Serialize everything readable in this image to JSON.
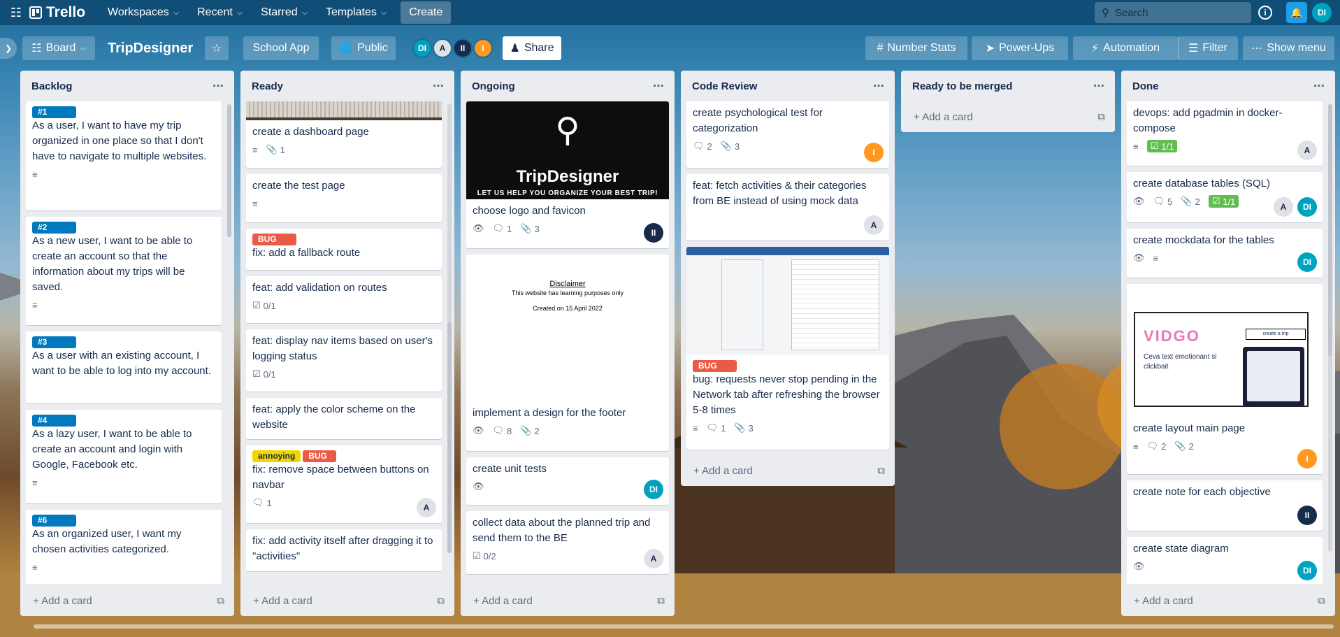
{
  "app": {
    "name": "Trello"
  },
  "topnav": {
    "items": [
      {
        "label": "Workspaces"
      },
      {
        "label": "Recent"
      },
      {
        "label": "Starred"
      },
      {
        "label": "Templates"
      }
    ],
    "create_label": "Create",
    "search_placeholder": "Search",
    "user_initials": "DI"
  },
  "boardbar": {
    "view_label": "Board",
    "title": "TripDesigner",
    "workspace_label": "School App",
    "visibility_label": "Public",
    "members": [
      "DI",
      "A",
      "II",
      "I"
    ],
    "share_label": "Share",
    "number_stats_label": "Number Stats",
    "powerups_label": "Power-Ups",
    "automation_label": "Automation",
    "filter_label": "Filter",
    "show_menu_label": "Show menu"
  },
  "colors": {
    "blue_label": "#0079bf",
    "red_label": "#eb5a46",
    "yellow_label": "#f2d600",
    "green_check": "#61bd4f"
  },
  "add_card_label": "Add a card",
  "lists": [
    {
      "title": "Backlog",
      "cards": [
        {
          "labels": [
            "#1"
          ],
          "title": "As a user, I want to have my trip organized in one place so that I don't have to navigate to multiple websites."
        },
        {
          "labels": [
            "#2"
          ],
          "title": "As a new user, I want to be able to create an account so that the information about my trips will be saved."
        },
        {
          "labels": [
            "#3"
          ],
          "title": "As a user with an existing account, I want to be able to log into my account."
        },
        {
          "labels": [
            "#4"
          ],
          "title": "As a lazy user, I want to be able to create an account and login with Google, Facebook etc."
        },
        {
          "labels": [
            "#6"
          ],
          "title": "As an organized user, I want my chosen activities categorized."
        }
      ]
    },
    {
      "title": "Ready",
      "cards": [
        {
          "title": "create a dashboard page",
          "attachments": "1"
        },
        {
          "title": "create the test page"
        },
        {
          "labels": [
            "BUG"
          ],
          "title": "fix: add a fallback route"
        },
        {
          "title": "feat: add validation on routes",
          "checklist": "0/1"
        },
        {
          "title": "feat: display nav items based on user's logging status",
          "checklist": "0/1"
        },
        {
          "title": "feat: apply the color scheme on the website"
        },
        {
          "labels": [
            "annoying",
            "BUG"
          ],
          "title": "fix: remove space between buttons on navbar",
          "comments": "1",
          "member": "A"
        },
        {
          "title": "fix: add activity itself after dragging it to \"activities\""
        }
      ]
    },
    {
      "title": "Ongoing",
      "cards": [
        {
          "cover_title": "TripDesigner",
          "cover_tagline": "LET US HELP YOU ORGANIZE YOUR BEST TRIP!",
          "title": "choose logo and favicon",
          "comments": "1",
          "attachments": "3",
          "member": "II"
        },
        {
          "cover_heading": "Disclaimer",
          "cover_line1": "This website has learning purposes only",
          "cover_line2": "Created on 15 April 2022",
          "title": "implement a design for the footer",
          "comments": "8",
          "attachments": "2"
        },
        {
          "title": "create unit tests",
          "member": "DI"
        },
        {
          "title": "collect data about the planned trip and send them to the BE",
          "checklist": "0/2",
          "member": "A"
        }
      ]
    },
    {
      "title": "Code Review",
      "cards": [
        {
          "title": "create psychological test for categorization",
          "comments": "2",
          "attachments": "3",
          "member": "I"
        },
        {
          "title": "feat: fetch activities & their categories from BE instead of using mock data",
          "member": "A"
        },
        {
          "labels": [
            "BUG"
          ],
          "title": "bug: requests never stop pending in the Network tab after refreshing the browser 5-8 times",
          "comments": "1",
          "attachments": "3"
        }
      ]
    },
    {
      "title": "Ready to be merged",
      "cards": []
    },
    {
      "title": "Done",
      "cards": [
        {
          "title": "devops: add pgadmin in docker-compose",
          "checklist": "1/1",
          "member": "A"
        },
        {
          "title": "create database tables (SQL)",
          "comments": "5",
          "attachments": "2",
          "checklist": "1/1",
          "members": [
            "A",
            "DI"
          ]
        },
        {
          "title": "create mockdata for the tables",
          "member": "DI"
        },
        {
          "cover_brand": "VIDGO",
          "cover_text": "Ceva text emotionant si clickbait",
          "cover_button": "create a trip",
          "title": "create layout main page",
          "comments": "2",
          "attachments": "2",
          "member": "I"
        },
        {
          "title": "create note for each objective",
          "member": "II"
        },
        {
          "title": "create state diagram",
          "member": "DI"
        }
      ]
    }
  ]
}
